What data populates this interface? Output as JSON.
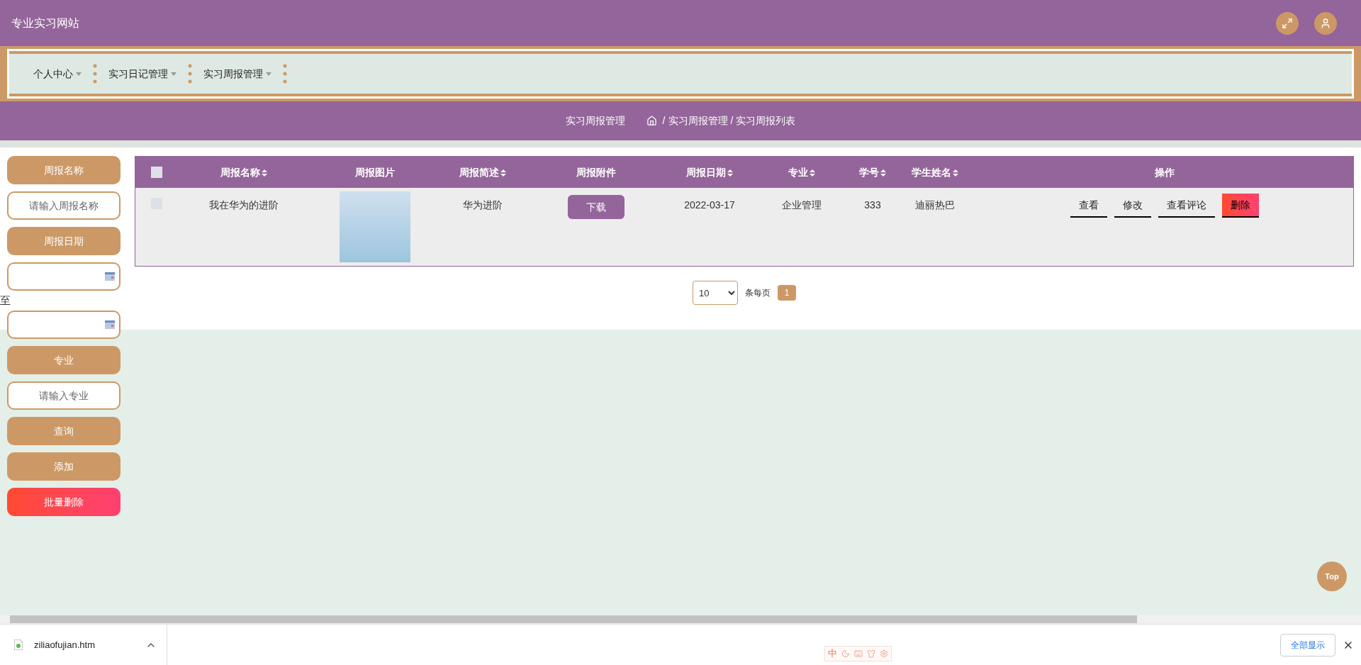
{
  "header": {
    "title": "专业实习网站"
  },
  "nav": {
    "items": [
      {
        "label": "个人中心"
      },
      {
        "label": "实习日记管理"
      },
      {
        "label": "实习周报管理"
      }
    ]
  },
  "breadcrumb": {
    "title": "实习周报管理",
    "separator": "/",
    "path": [
      "实习周报管理",
      "实习周报列表"
    ]
  },
  "search": {
    "items": [
      {
        "kind": "label",
        "text": "周报名称"
      },
      {
        "kind": "input",
        "placeholder": "请输入周报名称"
      },
      {
        "kind": "label",
        "text": "周报日期"
      },
      {
        "kind": "date"
      },
      {
        "kind": "separator",
        "text": "至"
      },
      {
        "kind": "date"
      },
      {
        "kind": "label",
        "text": "专业"
      },
      {
        "kind": "input",
        "placeholder": "请输入专业"
      },
      {
        "kind": "button",
        "text": "查询"
      },
      {
        "kind": "button",
        "text": "添加"
      },
      {
        "kind": "danger",
        "text": "批量删除"
      }
    ]
  },
  "table": {
    "select_all": {
      "checked": false
    },
    "columns": [
      {
        "label": "周报名称",
        "sortable": true
      },
      {
        "label": "周报图片",
        "sortable": false
      },
      {
        "label": "周报简述",
        "sortable": true
      },
      {
        "label": "周报附件",
        "sortable": false
      },
      {
        "label": "周报日期",
        "sortable": true
      },
      {
        "label": "专业",
        "sortable": true
      },
      {
        "label": "学号",
        "sortable": true
      },
      {
        "label": "学生姓名",
        "sortable": true
      },
      {
        "label": "操作",
        "sortable": false
      }
    ],
    "rows": [
      {
        "checked": false,
        "name": "我在华为的进阶",
        "summary": "华为进阶",
        "attachment": "下载",
        "date": "2022-03-17",
        "major": "企业管理",
        "student_id": "333",
        "student_name": "迪丽热巴",
        "actions": [
          {
            "kind": "plain",
            "label": "查看"
          },
          {
            "kind": "plain",
            "label": "修改"
          },
          {
            "kind": "plain",
            "label": "查看评论"
          },
          {
            "kind": "danger",
            "label": "删除"
          }
        ]
      }
    ]
  },
  "pagination": {
    "page_size": "10",
    "per_page_label": "条每页",
    "pages": [
      {
        "label": "1",
        "selected": true
      }
    ]
  },
  "back_to_top": "Top",
  "download_bar": {
    "file": "ziliaofujian.htm",
    "show_all": "全部显示"
  },
  "ime_toolbar": {
    "mode": "中"
  }
}
